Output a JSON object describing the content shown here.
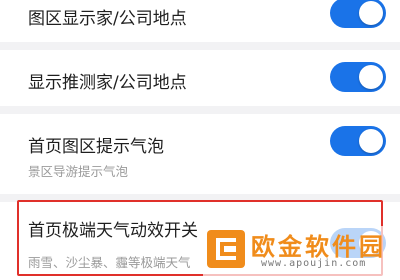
{
  "settings": [
    {
      "title": "图区显示家/公司地点",
      "subtitle": "",
      "enabled": true
    },
    {
      "title": "显示推测家/公司地点",
      "subtitle": "",
      "enabled": true
    },
    {
      "title": "首页图区提示气泡",
      "subtitle": "景区导游提示气泡",
      "enabled": true
    },
    {
      "title": "首页极端天气动效开关",
      "subtitle": "雨雪、沙尘暴、霾等极端天气",
      "enabled": true
    }
  ],
  "watermark": {
    "brand_text": "欧金软件园",
    "url": "www.apoujin.com"
  },
  "colors": {
    "toggle_on": "#1a73e8",
    "highlight_border": "#e0302a",
    "watermark": "#f08c1b"
  },
  "icons": {
    "watermark_logo": "orange-square-logo-icon"
  }
}
